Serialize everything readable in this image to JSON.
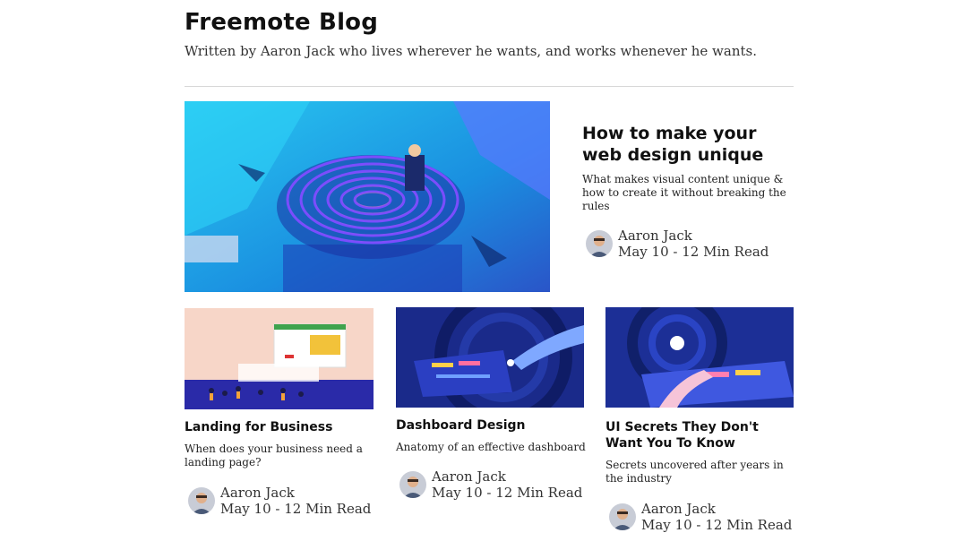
{
  "blog": {
    "title": "Freemote Blog",
    "subtitle": "Written by Aaron Jack who lives wherever he wants, and works whenever he wants."
  },
  "featured": {
    "title": "How to make your web design unique",
    "description": "What makes visual content unique & how to create it without breaking the rules",
    "author": "Aaron Jack",
    "meta": "May 10 - 12 Min Read"
  },
  "posts": [
    {
      "title": "Landing for Business",
      "description": "When does your business need a landing page?",
      "author": "Aaron Jack",
      "meta": "May 10 - 12 Min Read"
    },
    {
      "title": "Dashboard Design",
      "description": "Anatomy of an effective dashboard",
      "author": "Aaron Jack",
      "meta": "May 10 - 12 Min Read"
    },
    {
      "title": "UI Secrets They Don't Want You To Know",
      "description": "Secrets uncovered after years in the industry",
      "author": "Aaron Jack",
      "meta": "May 10 - 12 Min Read"
    }
  ],
  "colors": {
    "text": "#111111",
    "divider": "#d8d8d8",
    "featured_bg": "#1fb6e8",
    "dashboard_bg": "#1a2a8a",
    "secrets_bg": "#1c2f96",
    "landing_bg": "#f7d6c8"
  }
}
